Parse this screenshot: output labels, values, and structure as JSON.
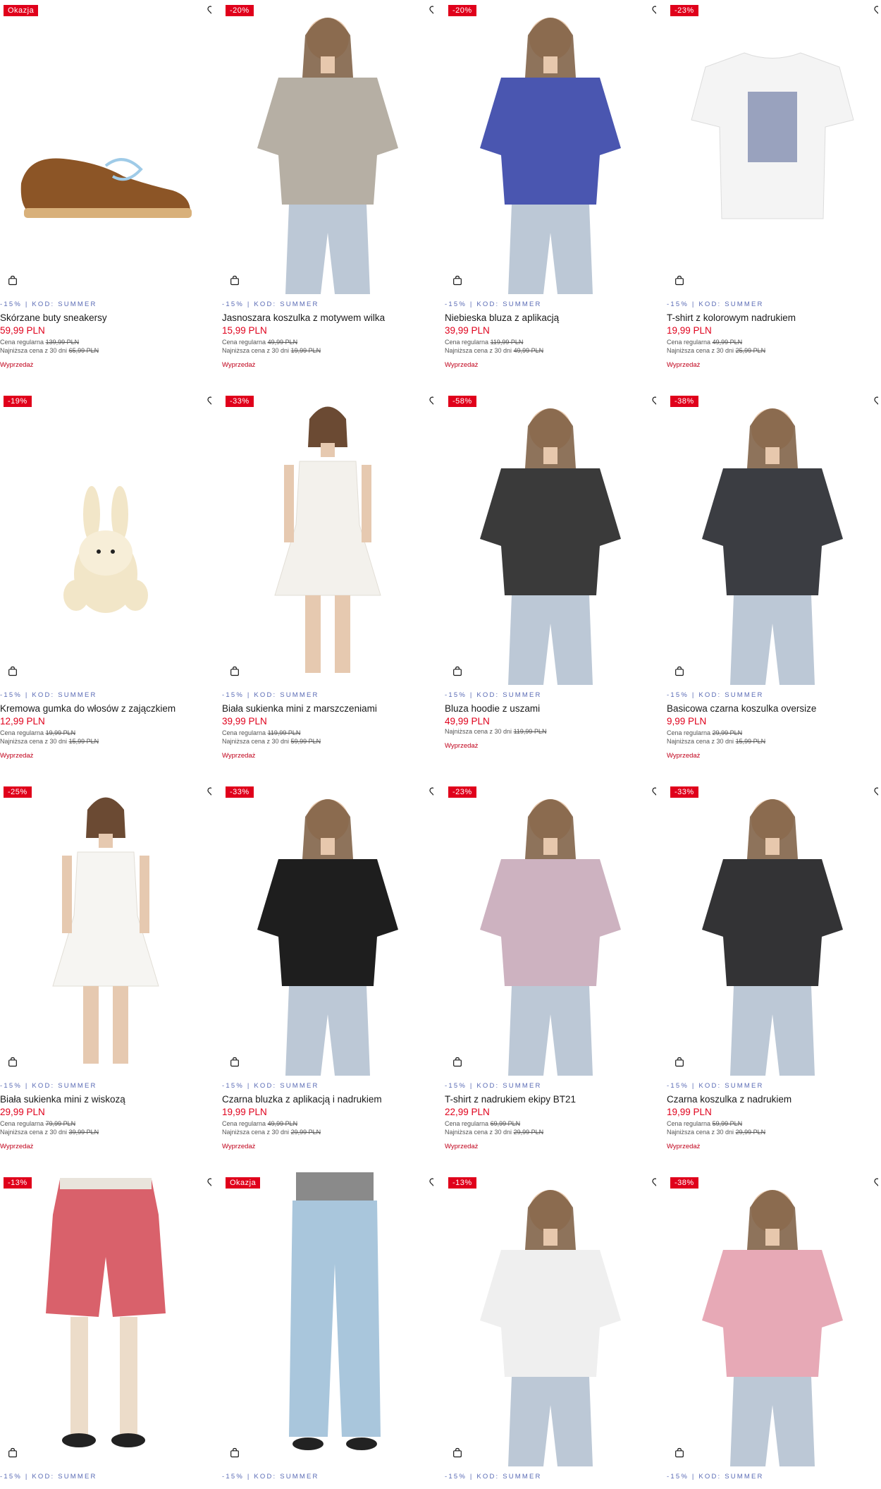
{
  "products": [
    {
      "badge": "Okazja",
      "promo": "-15% | KOD: SUMMER",
      "name": "Skórzane buty sneakersy",
      "price": "59,99 PLN",
      "regular_label": "Cena regularna",
      "regular_price": "139,99 PLN",
      "lowest_label": "Najniższa cena z 30 dni",
      "lowest_price": "65,99 PLN",
      "sale": "Wyprzedaż",
      "kind": "shoe",
      "color": "#8c5526"
    },
    {
      "badge": "-20%",
      "promo": "-15% | KOD: SUMMER",
      "name": "Jasnoszara koszulka z motywem wilka",
      "price": "15,99 PLN",
      "regular_label": "Cena regularna",
      "regular_price": "49,99 PLN",
      "lowest_label": "Najniższa cena z 30 dni",
      "lowest_price": "19,99 PLN",
      "sale": "Wyprzedaż",
      "kind": "model",
      "color": "#b6afa4"
    },
    {
      "badge": "-20%",
      "promo": "-15% | KOD: SUMMER",
      "name": "Niebieska bluza z aplikacją",
      "price": "39,99 PLN",
      "regular_label": "Cena regularna",
      "regular_price": "119,99 PLN",
      "lowest_label": "Najniższa cena z 30 dni",
      "lowest_price": "49,99 PLN",
      "sale": "Wyprzedaż",
      "kind": "model",
      "color": "#4a56b0"
    },
    {
      "badge": "-23%",
      "promo": "-15% | KOD: SUMMER",
      "name": "T-shirt z kolorowym nadrukiem",
      "price": "19,99 PLN",
      "regular_label": "Cena regularna",
      "regular_price": "49,99 PLN",
      "lowest_label": "Najniższa cena z 30 dni",
      "lowest_price": "25,99 PLN",
      "sale": "Wyprzedaż",
      "kind": "flat",
      "color": "#f4f4f4"
    },
    {
      "badge": "-19%",
      "promo": "-15% | KOD: SUMMER",
      "name": "Kremowa gumka do włosów z zajączkiem",
      "price": "12,99 PLN",
      "regular_label": "Cena regularna",
      "regular_price": "19,99 PLN",
      "lowest_label": "Najniższa cena z 30 dni",
      "lowest_price": "15,99 PLN",
      "sale": "Wyprzedaż",
      "kind": "bunny",
      "color": "#f2e6c8"
    },
    {
      "badge": "-33%",
      "promo": "-15% | KOD: SUMMER",
      "name": "Biała sukienka mini z marszczeniami",
      "price": "39,99 PLN",
      "regular_label": "Cena regularna",
      "regular_price": "119,99 PLN",
      "lowest_label": "Najniższa cena z 30 dni",
      "lowest_price": "59,99 PLN",
      "sale": "Wyprzedaż",
      "kind": "dress",
      "color": "#f3f1ec"
    },
    {
      "badge": "-58%",
      "promo": "-15% | KOD: SUMMER",
      "name": "Bluza hoodie z uszami",
      "price": "49,99 PLN",
      "regular_label": "",
      "regular_price": "",
      "lowest_label": "Najniższa cena z 30 dni",
      "lowest_price": "119,99 PLN",
      "sale": "Wyprzedaż",
      "kind": "model",
      "color": "#3a3a3a"
    },
    {
      "badge": "-38%",
      "promo": "-15% | KOD: SUMMER",
      "name": "Basicowa czarna koszulka oversize",
      "price": "9,99 PLN",
      "regular_label": "Cena regularna",
      "regular_price": "29,99 PLN",
      "lowest_label": "Najniższa cena z 30 dni",
      "lowest_price": "15,99 PLN",
      "sale": "Wyprzedaż",
      "kind": "model",
      "color": "#3b3d42"
    },
    {
      "badge": "-25%",
      "promo": "-15% | KOD: SUMMER",
      "name": "Biała sukienka mini z wiskozą",
      "price": "29,99 PLN",
      "regular_label": "Cena regularna",
      "regular_price": "79,99 PLN",
      "lowest_label": "Najniższa cena z 30 dni",
      "lowest_price": "39,99 PLN",
      "sale": "Wyprzedaż",
      "kind": "dress",
      "color": "#f6f5f2"
    },
    {
      "badge": "-33%",
      "promo": "-15% | KOD: SUMMER",
      "name": "Czarna bluzka z aplikacją i nadrukiem",
      "price": "19,99 PLN",
      "regular_label": "Cena regularna",
      "regular_price": "49,99 PLN",
      "lowest_label": "Najniższa cena z 30 dni",
      "lowest_price": "29,99 PLN",
      "sale": "Wyprzedaż",
      "kind": "model",
      "color": "#1e1e1e"
    },
    {
      "badge": "-23%",
      "promo": "-15% | KOD: SUMMER",
      "name": "T-shirt z nadrukiem ekipy BT21",
      "price": "22,99 PLN",
      "regular_label": "Cena regularna",
      "regular_price": "69,99 PLN",
      "lowest_label": "Najniższa cena z 30 dni",
      "lowest_price": "29,99 PLN",
      "sale": "Wyprzedaż",
      "kind": "model",
      "color": "#cdb2c0"
    },
    {
      "badge": "-33%",
      "promo": "-15% | KOD: SUMMER",
      "name": "Czarna koszulka z nadrukiem",
      "price": "19,99 PLN",
      "regular_label": "Cena regularna",
      "regular_price": "59,99 PLN",
      "lowest_label": "Najniższa cena z 30 dni",
      "lowest_price": "29,99 PLN",
      "sale": "Wyprzedaż",
      "kind": "model",
      "color": "#333335"
    },
    {
      "badge": "-13%",
      "promo": "-15% | KOD: SUMMER",
      "name": "",
      "price": "",
      "regular_label": "",
      "regular_price": "",
      "lowest_label": "",
      "lowest_price": "",
      "sale": "",
      "kind": "shorts",
      "color": "#d9616b"
    },
    {
      "badge": "Okazja",
      "promo": "-15% | KOD: SUMMER",
      "name": "",
      "price": "",
      "regular_label": "",
      "regular_price": "",
      "lowest_label": "",
      "lowest_price": "",
      "sale": "",
      "kind": "jeans",
      "color": "#a9c6dc"
    },
    {
      "badge": "-13%",
      "promo": "-15% | KOD: SUMMER",
      "name": "",
      "price": "",
      "regular_label": "",
      "regular_price": "",
      "lowest_label": "",
      "lowest_price": "",
      "sale": "",
      "kind": "model",
      "color": "#efefef"
    },
    {
      "badge": "-38%",
      "promo": "-15% | KOD: SUMMER",
      "name": "",
      "price": "",
      "regular_label": "",
      "regular_price": "",
      "lowest_label": "",
      "lowest_price": "",
      "sale": "",
      "kind": "model",
      "color": "#e7a9b6"
    }
  ],
  "colors": {
    "badge": "#e0001b",
    "price": "#e0001b",
    "promo": "#5a6bb5",
    "sale": "#c0001a"
  },
  "icons": {
    "favorite": "heart-icon",
    "cart": "shopping-bag-icon"
  }
}
